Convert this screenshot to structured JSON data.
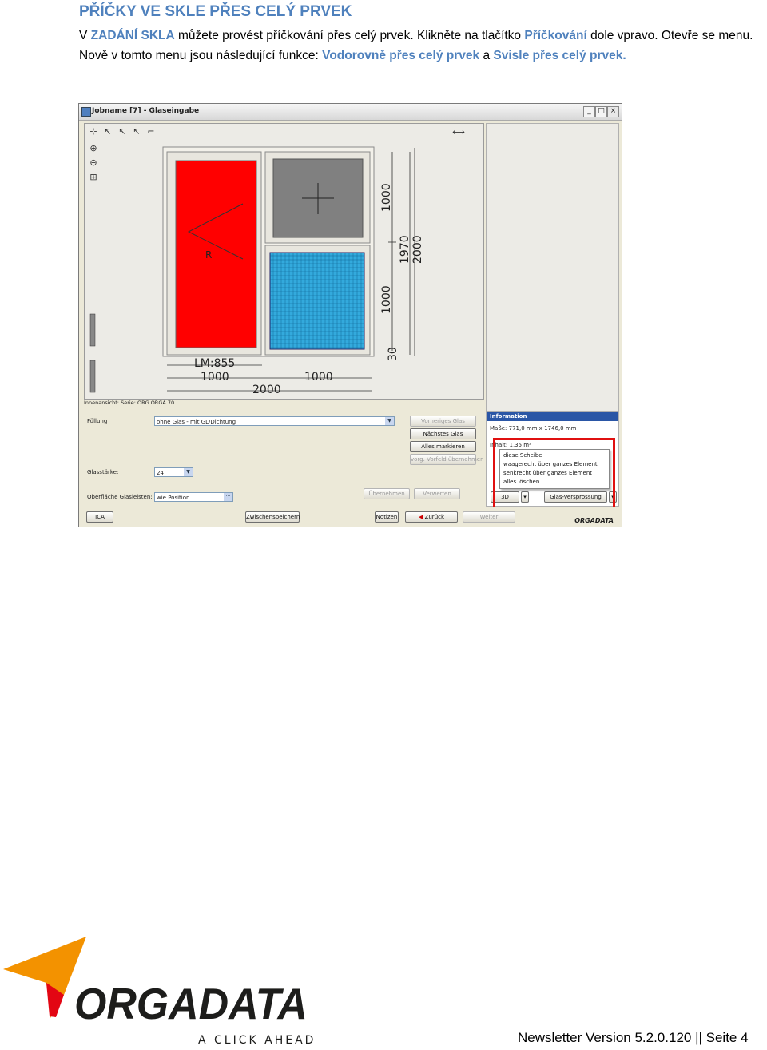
{
  "heading": "PŘÍČKY VE SKLE PŘES CELÝ PRVEK",
  "paragraph": {
    "p1": "V ",
    "h1": "ZADÁNÍ SKLA",
    "p2": " můžete provést příčkování přes celý prvek. Klikněte na tlačítko ",
    "h2": "Příčkování",
    "p3": " dole vpravo. Otevře se menu. Nově v tomto menu jsou následující funkce: ",
    "h3": "Vodorovně přes celý prvek",
    "p4": " a ",
    "h4": "Svisle přes celý prvek."
  },
  "window": {
    "title": "Jobname [7] - Glaseingabe",
    "min_glyph": "_",
    "max_glyph": "□",
    "close_glyph": "×"
  },
  "drawing": {
    "sash_label": "R",
    "lm_label": "LM:855",
    "dim_bottom_left": "1000",
    "dim_bottom_right": "1000",
    "dim_total_width": "2000",
    "dim_top_right": "1000",
    "dim_lower_right": "1000",
    "dim_mid": "1970",
    "dim_total_height": "2000",
    "dim_small": "30",
    "fill_red": "#ff0000",
    "fill_grey": "#808080",
    "fill_cyan": "#33aadd"
  },
  "status": {
    "view": "Innenansicht:",
    "series": "Serie: ORG ORGA 70"
  },
  "form": {
    "fuellung_label": "Füllung",
    "fuellung_value": "ohne Glas - mit GL/Dichtung",
    "glasstaerke_label": "Glasstärke:",
    "glasstaerke_value": "24",
    "oberflaeche_label": "Oberfläche Glasleisten:",
    "oberflaeche_value": "wie Position",
    "btn_prev": "Vorheriges Glas",
    "btn_next": "Nächstes Glas",
    "btn_mark": "Alles markieren",
    "btn_apply_default": "vorg. Vorfeld übernehmen",
    "btn_uebernehmen": "Übernehmen",
    "btn_verwerfen": "Verwerfen"
  },
  "info": {
    "header": "Information",
    "masse": "Maße:  771,0 mm x 1746,0 mm",
    "inhalt": "Inhalt:  1,35 m²",
    "btn_3d": "3D",
    "btn_sprossung": "Glas-Versprossung",
    "popup": [
      "diese Scheibe",
      "waagerecht über ganzes Element",
      "senkrecht über ganzes Element",
      "alles löschen"
    ]
  },
  "bottom": {
    "btn_left": "ICA",
    "btn_zwischen": "Zwischenspeichern",
    "btn_notizen": "Notizen",
    "btn_zurueck": "Zurück",
    "btn_weiter": "Weiter",
    "brand_small": "ORGADATA"
  },
  "logo": {
    "wordmark": "ORGADATA",
    "tagline": "A CLICK AHEAD",
    "color_orange": "#f39200",
    "color_red": "#e30613"
  },
  "footer": "Newsletter Version 5.2.0.120  ||  Seite 4"
}
